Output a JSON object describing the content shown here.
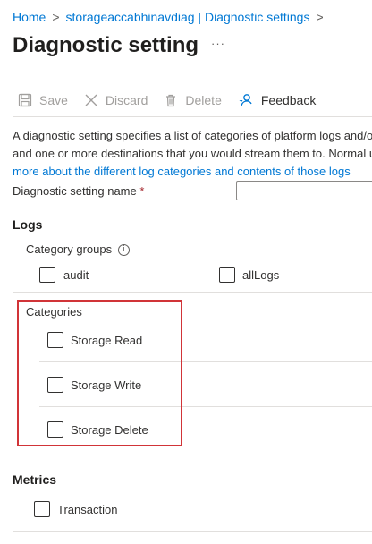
{
  "breadcrumb": {
    "home": "Home",
    "separator": ">",
    "resource": "storageaccabhinavdiag | Diagnostic settings"
  },
  "page": {
    "title": "Diagnostic setting",
    "more": "···"
  },
  "toolbar": {
    "save_label": "Save",
    "discard_label": "Discard",
    "delete_label": "Delete",
    "feedback_label": "Feedback"
  },
  "description": {
    "line1": "A diagnostic setting specifies a list of categories of platform logs and/or metrics that you want to collect from a resource,",
    "line2": "and one or more destinations that you would stream them to. Normal usage charges for the destination will occur. Learn",
    "line3": "more about the different log categories and contents of those logs"
  },
  "name_field": {
    "label": "Diagnostic setting name",
    "required_mark": "*",
    "value": ""
  },
  "logs": {
    "heading": "Logs",
    "category_groups_label": "Category groups",
    "info_icon": "i",
    "groups": [
      {
        "label": "audit",
        "checked": false
      },
      {
        "label": "allLogs",
        "checked": false
      }
    ],
    "categories_label": "Categories",
    "categories": [
      {
        "label": "Storage Read",
        "checked": false
      },
      {
        "label": "Storage Write",
        "checked": false
      },
      {
        "label": "Storage Delete",
        "checked": false
      }
    ]
  },
  "metrics": {
    "heading": "Metrics",
    "items": [
      {
        "label": "Transaction",
        "checked": false
      }
    ]
  },
  "colors": {
    "link": "#0078d4",
    "highlight_box": "#d13438",
    "required": "#a4262c"
  }
}
